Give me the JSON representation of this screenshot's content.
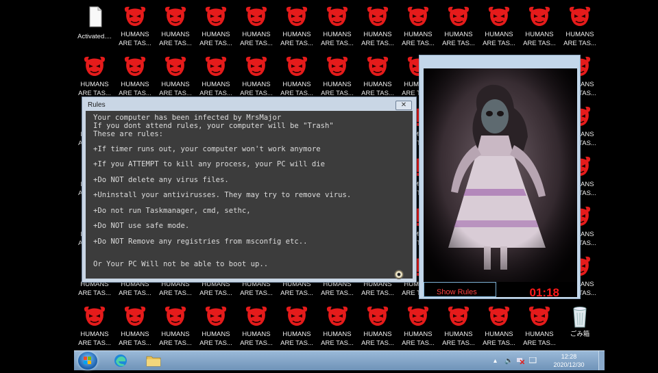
{
  "desktop": {
    "first_icon_label": "Activated....",
    "humans_label": [
      "HUMANS",
      "ARE TAS..."
    ],
    "recycle_label": "ごみ箱"
  },
  "rules_window": {
    "title": "Rules",
    "close_glyph": "✕",
    "lines": [
      "Your computer has been infected by MrsMajor",
      "If you dont attend rules, your computer will be \"Trash\"",
      "These are rules:",
      "+If timer runs out, your computer won't work anymore",
      "+If you ATTEMPT to kill any process, your PC will die",
      "+Do NOT delete any virus files.",
      "+Uninstall your antivirusses. They may try to remove virus.",
      "+Do not run Taskmanager, cmd, sethc,",
      "+Do NOT use safe mode.",
      "+Do NOT Remove any registries from msconfig etc..",
      "Or Your PC Will not be able to boot up.."
    ]
  },
  "image_window": {
    "show_rules_label": "Show Rules",
    "timer": "01:18"
  },
  "taskbar": {
    "time": "12:28",
    "date": "2020/12/30",
    "icons": [
      "windows-start-icon",
      "edge-icon",
      "folder-icon"
    ],
    "tray_icons": [
      "chevron-up-icon",
      "speaker-icon",
      "network-x-icon",
      "action-center-icon"
    ]
  },
  "colors": {
    "mask_red": "#e51b1b",
    "timer_red": "#ff1a1a",
    "window_frame": "#c9d6e5",
    "rules_bg": "#3c3c3c"
  }
}
